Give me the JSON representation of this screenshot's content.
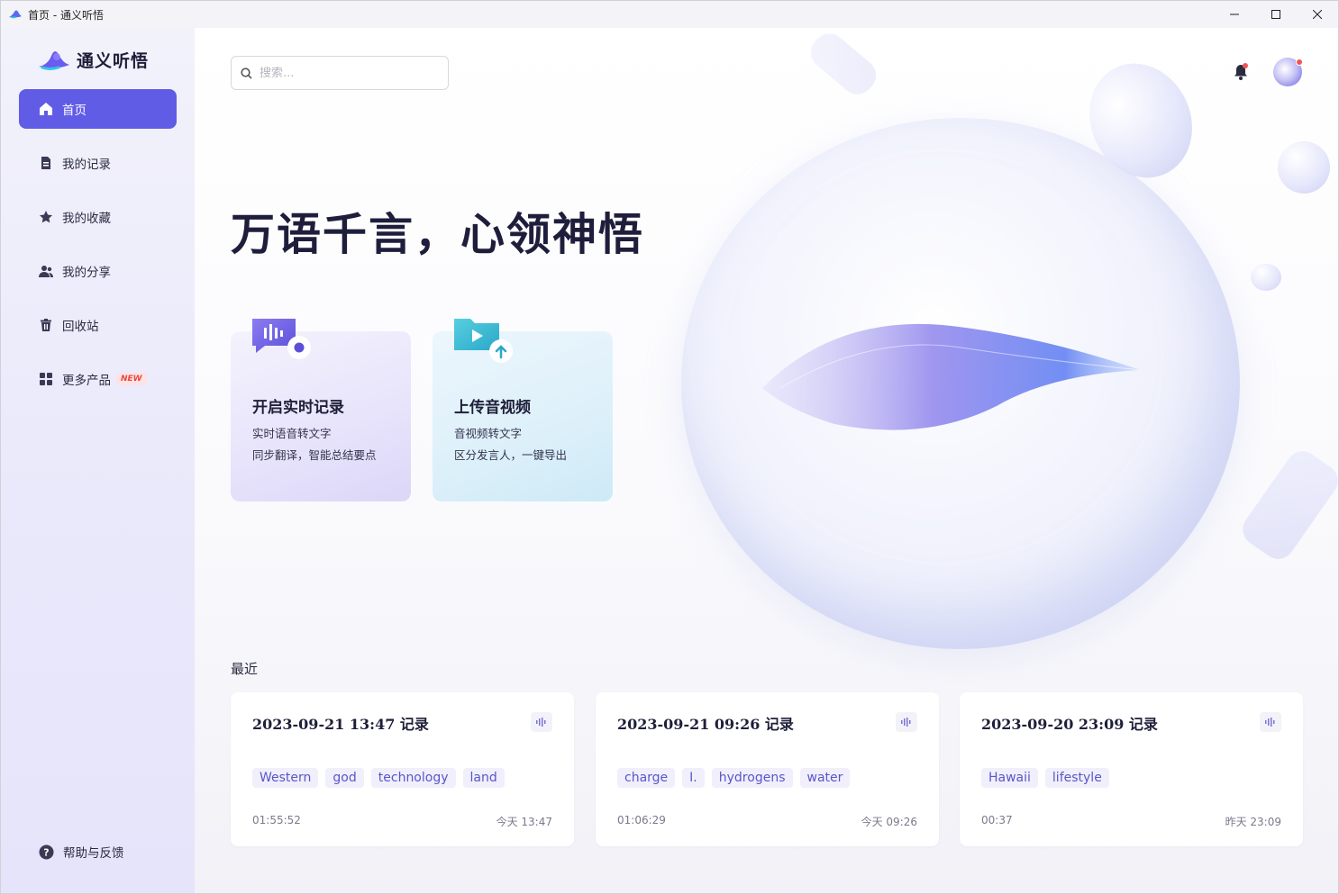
{
  "window": {
    "title": "首页 - 通义听悟"
  },
  "app": {
    "name": "通义听悟"
  },
  "sidebar": {
    "items": [
      {
        "label": "首页",
        "icon": "home-icon",
        "active": true
      },
      {
        "label": "我的记录",
        "icon": "document-icon"
      },
      {
        "label": "我的收藏",
        "icon": "star-icon"
      },
      {
        "label": "我的分享",
        "icon": "people-icon"
      },
      {
        "label": "回收站",
        "icon": "trash-icon"
      },
      {
        "label": "更多产品",
        "icon": "grid-icon",
        "badge": "NEW"
      }
    ],
    "help": "帮助与反馈"
  },
  "search": {
    "placeholder": "搜索..."
  },
  "hero": {
    "title": "万语千言，心领神悟"
  },
  "actions": [
    {
      "title": "开启实时记录",
      "line1": "实时语音转文字",
      "line2": "同步翻译，智能总结要点",
      "icon": "mic-bubble-icon"
    },
    {
      "title": "上传音视频",
      "line1": "音视频转文字",
      "line2": "区分发言人，一键导出",
      "icon": "upload-folder-icon"
    }
  ],
  "recent": {
    "label": "最近",
    "cards": [
      {
        "title": "2023-09-21 13:47 记录",
        "tags": [
          "Western",
          "god",
          "technology",
          "land"
        ],
        "duration": "01:55:52",
        "time": "今天 13:47"
      },
      {
        "title": "2023-09-21 09:26 记录",
        "tags": [
          "charge",
          "I.",
          "hydrogens",
          "water"
        ],
        "duration": "01:06:29",
        "time": "今天 09:26"
      },
      {
        "title": "2023-09-20 23:09 记录",
        "tags": [
          "Hawaii",
          "lifestyle"
        ],
        "duration": "00:37",
        "time": "昨天 23:09"
      }
    ]
  },
  "colors": {
    "accent": "#615ce6",
    "badge": "#e8493f",
    "tag_text": "#5a56c9"
  }
}
